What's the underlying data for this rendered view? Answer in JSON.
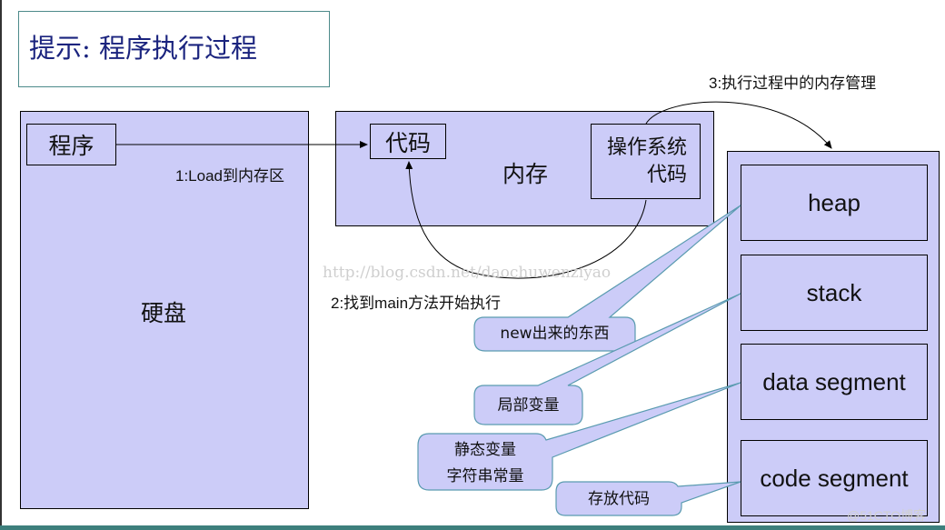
{
  "title": "提示: 程序执行过程",
  "disk": {
    "label": "硬盘",
    "program_label": "程序"
  },
  "memory": {
    "label": "内存",
    "code_label": "代码",
    "os_code_label_line1": "操作系统",
    "os_code_label_line2": "代码"
  },
  "steps": {
    "step1": "1:Load到内存区",
    "step2": "2:找到main方法开始执行",
    "step3": "3:执行过程中的内存管理"
  },
  "segments": [
    {
      "name": "heap",
      "callout": "new出来的东西"
    },
    {
      "name": "stack",
      "callout": "局部变量"
    },
    {
      "name": "data segment",
      "callout_line1": "静态变量",
      "callout_line2": "字符串常量"
    },
    {
      "name": "code segment",
      "callout": "存放代码"
    }
  ],
  "watermarks": {
    "blog_url": "http://blog.csdn.net/daochuwenziyao",
    "site": "@51CTO博客"
  },
  "colors": {
    "panel_fill": "#ccccf8",
    "title_text": "#1a237e",
    "callout_stroke": "#5a9bb0",
    "bottom_bar": "#3d7f7c"
  }
}
